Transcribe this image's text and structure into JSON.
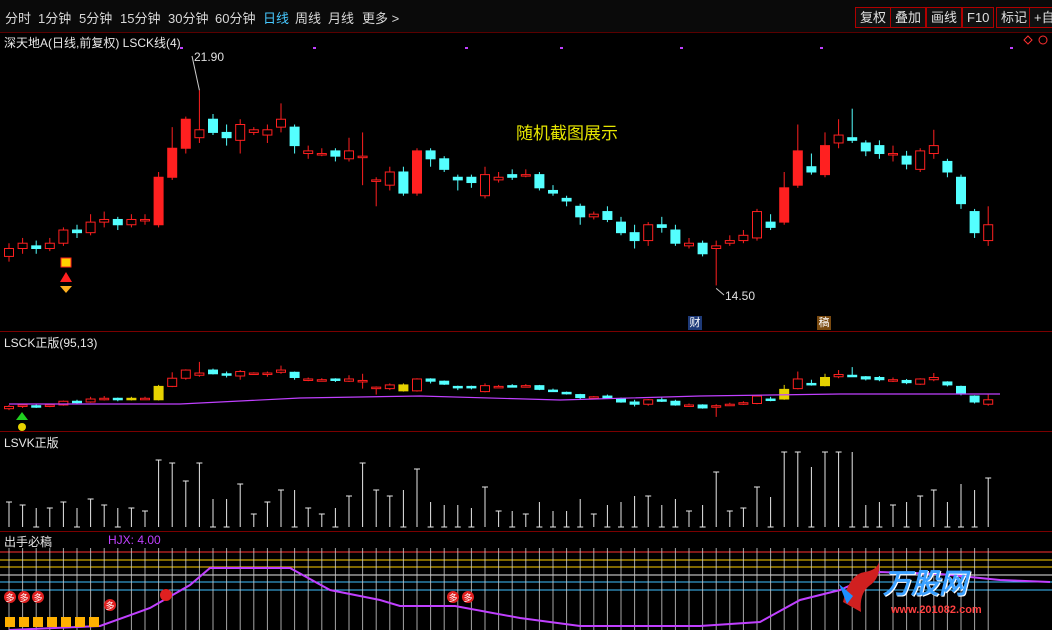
{
  "toolbar": {
    "periods": [
      "分时",
      "1分钟",
      "5分钟",
      "15分钟",
      "30分钟",
      "60分钟",
      "日线",
      "周线",
      "月线",
      "更多 >"
    ],
    "active_period": "日线",
    "buttons": [
      "复权",
      "叠加",
      "画线",
      "F10",
      "标记",
      "+自"
    ]
  },
  "main_panel": {
    "title": "深天地A(日线,前复权) LSCK线(4)",
    "high_label": "21.90",
    "low_label": "14.50",
    "caption": "随机截图展示",
    "event_badges": [
      "财",
      "稿"
    ]
  },
  "indicator1": {
    "title": "LSCK正版(95,13)"
  },
  "indicator2": {
    "title": "LSVK正版"
  },
  "indicator3": {
    "title": "出手必稿",
    "hjx_label": "HJX: 4.00",
    "signal_text": "多"
  },
  "logo": {
    "brand": "万股网",
    "url": "www.201082.com"
  },
  "colors": {
    "up": "#ff2020",
    "down": "#54ffff",
    "accent": "#47c8ff",
    "border": "#7a0000",
    "purple": "#c040ff",
    "yellow": "#e6e600"
  },
  "chart_data": {
    "type": "candlestick",
    "y_range": [
      13.0,
      23.5
    ],
    "annotations": [
      {
        "label": "21.90",
        "value": 21.9
      },
      {
        "label": "14.50",
        "value": 14.5
      }
    ],
    "candles": [
      [
        15.6,
        15.9,
        16.1,
        15.4
      ],
      [
        15.9,
        16.1,
        16.3,
        15.7
      ],
      [
        16.0,
        15.9,
        16.2,
        15.7
      ],
      [
        15.9,
        16.1,
        16.3,
        15.8
      ],
      [
        16.1,
        16.6,
        16.7,
        16.0
      ],
      [
        16.6,
        16.5,
        16.8,
        16.3
      ],
      [
        16.5,
        16.9,
        17.2,
        16.4
      ],
      [
        16.9,
        17.0,
        17.3,
        16.7
      ],
      [
        17.0,
        16.8,
        17.1,
        16.6
      ],
      [
        16.8,
        17.0,
        17.2,
        16.7
      ],
      [
        17.0,
        17.0,
        17.2,
        16.8
      ],
      [
        16.8,
        18.6,
        18.8,
        16.7
      ],
      [
        18.6,
        19.7,
        20.5,
        18.5
      ],
      [
        19.7,
        20.8,
        20.9,
        19.5
      ],
      [
        20.1,
        20.4,
        21.9,
        19.9
      ],
      [
        20.8,
        20.3,
        21.0,
        20.2
      ],
      [
        20.3,
        20.1,
        20.6,
        19.8
      ],
      [
        20.0,
        20.6,
        20.8,
        19.5
      ],
      [
        20.3,
        20.4,
        20.5,
        20.2
      ],
      [
        20.2,
        20.4,
        20.6,
        19.9
      ],
      [
        20.5,
        20.8,
        21.4,
        20.3
      ],
      [
        20.5,
        19.8,
        20.6,
        19.5
      ],
      [
        19.5,
        19.6,
        19.8,
        19.3
      ],
      [
        19.5,
        19.5,
        19.7,
        19.4
      ],
      [
        19.6,
        19.4,
        19.7,
        19.2
      ],
      [
        19.3,
        19.6,
        20.1,
        19.2
      ],
      [
        19.4,
        19.4,
        20.3,
        18.3
      ],
      [
        18.5,
        18.5,
        18.6,
        17.5
      ],
      [
        18.3,
        18.8,
        19.0,
        18.1
      ],
      [
        18.8,
        18.0,
        19.0,
        17.9
      ],
      [
        18.0,
        19.6,
        19.7,
        17.9
      ],
      [
        19.6,
        19.3,
        19.7,
        19.0
      ],
      [
        19.3,
        18.9,
        19.4,
        18.8
      ],
      [
        18.6,
        18.5,
        18.7,
        18.1
      ],
      [
        18.6,
        18.4,
        18.7,
        18.2
      ],
      [
        17.9,
        18.7,
        19.0,
        17.8
      ],
      [
        18.5,
        18.6,
        18.8,
        18.4
      ],
      [
        18.7,
        18.6,
        18.9,
        18.5
      ],
      [
        18.7,
        18.7,
        18.9,
        18.6
      ],
      [
        18.7,
        18.2,
        18.8,
        18.1
      ],
      [
        18.1,
        18.0,
        18.3,
        17.9
      ],
      [
        17.8,
        17.7,
        17.9,
        17.5
      ],
      [
        17.5,
        17.1,
        17.6,
        16.8
      ],
      [
        17.1,
        17.2,
        17.3,
        17.0
      ],
      [
        17.3,
        17.0,
        17.5,
        16.9
      ],
      [
        16.9,
        16.5,
        17.1,
        16.4
      ],
      [
        16.5,
        16.2,
        16.8,
        15.9
      ],
      [
        16.2,
        16.8,
        16.9,
        16.0
      ],
      [
        16.8,
        16.7,
        17.1,
        16.5
      ],
      [
        16.6,
        16.1,
        16.8,
        16.0
      ],
      [
        16.0,
        16.1,
        16.3,
        15.9
      ],
      [
        16.1,
        15.7,
        16.2,
        15.6
      ],
      [
        15.9,
        16.0,
        16.2,
        14.5
      ],
      [
        16.1,
        16.2,
        16.4,
        16.0
      ],
      [
        16.2,
        16.4,
        16.6,
        16.1
      ],
      [
        16.3,
        17.3,
        17.4,
        16.2
      ],
      [
        16.9,
        16.7,
        17.2,
        16.6
      ],
      [
        16.9,
        18.2,
        18.8,
        16.8
      ],
      [
        18.3,
        19.6,
        20.6,
        18.2
      ],
      [
        19.0,
        18.8,
        19.5,
        18.7
      ],
      [
        18.7,
        19.8,
        20.3,
        18.6
      ],
      [
        19.9,
        20.2,
        20.8,
        19.7
      ],
      [
        20.1,
        20.0,
        21.2,
        19.9
      ],
      [
        19.9,
        19.6,
        20.0,
        19.4
      ],
      [
        19.8,
        19.5,
        20.0,
        19.3
      ],
      [
        19.5,
        19.5,
        19.8,
        19.2
      ],
      [
        19.4,
        19.1,
        19.6,
        18.9
      ],
      [
        18.9,
        19.6,
        19.7,
        18.8
      ],
      [
        19.5,
        19.8,
        20.4,
        19.3
      ],
      [
        19.2,
        18.8,
        19.3,
        18.6
      ],
      [
        18.6,
        17.6,
        18.7,
        17.4
      ],
      [
        17.3,
        16.5,
        17.4,
        16.3
      ],
      [
        16.2,
        16.8,
        17.5,
        16.0
      ]
    ]
  }
}
